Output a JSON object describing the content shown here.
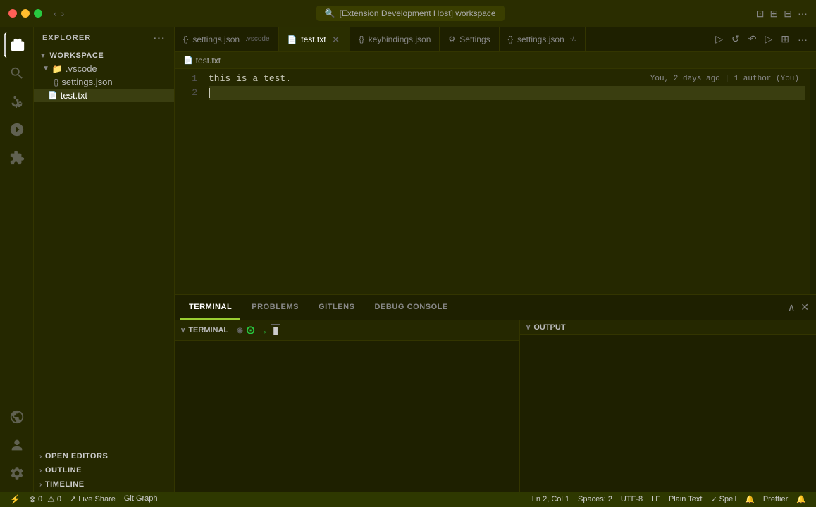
{
  "titleBar": {
    "title": "[Extension Development Host] workspace",
    "searchPlaceholder": "[Extension Development Host] workspace",
    "navBack": "◀",
    "navForward": "▶"
  },
  "activityBar": {
    "icons": [
      {
        "name": "explorer",
        "symbol": "⎘",
        "active": true
      },
      {
        "name": "search",
        "symbol": "🔍"
      },
      {
        "name": "source-control",
        "symbol": "⑃"
      },
      {
        "name": "run",
        "symbol": "▷"
      },
      {
        "name": "extensions",
        "symbol": "⊞"
      },
      {
        "name": "remote-explorer",
        "symbol": "⊡"
      }
    ],
    "bottomIcons": [
      {
        "name": "accounts",
        "symbol": "👤"
      },
      {
        "name": "settings",
        "symbol": "⚙"
      },
      {
        "name": "more",
        "symbol": "···"
      }
    ]
  },
  "sidebar": {
    "title": "EXPLORER",
    "moreIcon": "···",
    "workspace": {
      "label": "WORKSPACE",
      "vscode": {
        "label": ".vscode",
        "children": [
          {
            "label": "settings.json",
            "icon": "{}"
          }
        ]
      },
      "files": [
        {
          "label": "test.txt",
          "icon": "📄",
          "active": true
        }
      ]
    },
    "bottomSections": [
      {
        "label": "OPEN EDITORS",
        "collapsed": true
      },
      {
        "label": "OUTLINE",
        "collapsed": true
      },
      {
        "label": "TIMELINE",
        "collapsed": true
      }
    ]
  },
  "tabs": [
    {
      "label": "settings.json",
      "icon": "{}",
      "path": ".vscode",
      "active": false,
      "closable": false
    },
    {
      "label": "test.txt",
      "icon": "📄",
      "active": true,
      "closable": true
    },
    {
      "label": "keybindings.json",
      "icon": "{}",
      "active": false,
      "closable": false
    },
    {
      "label": "Settings",
      "icon": "⚙",
      "active": false,
      "closable": false
    },
    {
      "label": "settings.json",
      "icon": "{}",
      "path": "-/.",
      "active": false,
      "closable": false
    }
  ],
  "tabActions": [
    "▷",
    "↺",
    "↶",
    "▷",
    "⊞",
    "···"
  ],
  "breadcrumb": {
    "icon": "📄",
    "path": "test.txt"
  },
  "gitAnnotation": "You, 2 days ago | 1 author (You)",
  "editor": {
    "lines": [
      {
        "number": 1,
        "content": "this is a test.",
        "active": false
      },
      {
        "number": 2,
        "content": "",
        "active": true
      }
    ]
  },
  "panel": {
    "tabs": [
      {
        "label": "TERMINAL",
        "active": true
      },
      {
        "label": "PROBLEMS",
        "active": false
      },
      {
        "label": "GITLENS",
        "active": false
      },
      {
        "label": "DEBUG CONSOLE",
        "active": false
      }
    ],
    "terminalSection": {
      "label": "TERMINAL",
      "icons": {
        "circle": "◉",
        "arrow": "→",
        "box": "▮"
      }
    },
    "outputSection": {
      "label": "OUTPUT"
    }
  },
  "statusBar": {
    "left": [
      {
        "icon": "⚡",
        "label": "",
        "name": "remote-indicator",
        "green": true
      },
      {
        "icon": "⚠",
        "label": "0",
        "name": "errors"
      },
      {
        "icon": "⊗",
        "label": "0",
        "name": "warnings"
      },
      {
        "icon": "↗",
        "label": "Live Share",
        "name": "live-share"
      },
      {
        "icon": "",
        "label": "Git Graph",
        "name": "git-graph"
      }
    ],
    "right": [
      {
        "label": "Ln 2, Col 1",
        "name": "cursor-position"
      },
      {
        "label": "Spaces: 2",
        "name": "indentation"
      },
      {
        "label": "UTF-8",
        "name": "encoding"
      },
      {
        "label": "LF",
        "name": "line-endings"
      },
      {
        "label": "Plain Text",
        "name": "language-mode"
      },
      {
        "icon": "✓",
        "label": "Spell",
        "name": "spell-checker"
      },
      {
        "icon": "",
        "label": "",
        "name": "notification"
      },
      {
        "label": "Prettier",
        "name": "formatter"
      },
      {
        "icon": "🔔",
        "label": "",
        "name": "bell"
      }
    ]
  }
}
